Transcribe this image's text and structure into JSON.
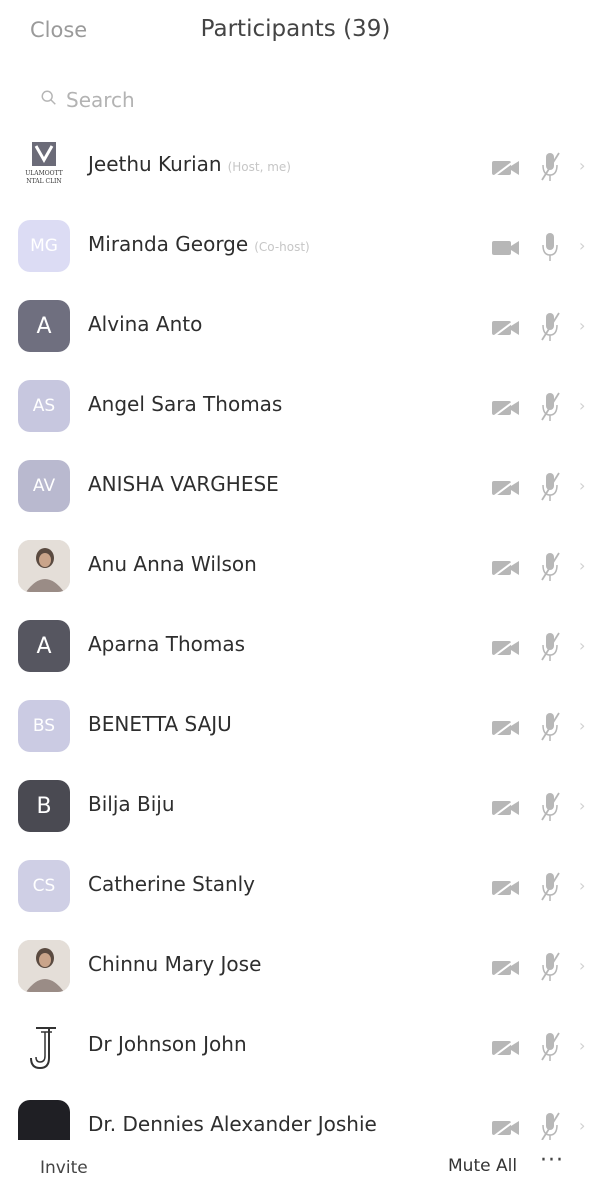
{
  "header": {
    "close_label": "Close",
    "title": "Participants (39)"
  },
  "search": {
    "placeholder": "Search",
    "icon": "search-icon"
  },
  "participants": [
    {
      "name": "Jeethu Kurian",
      "role": "(Host, me)",
      "avatar_type": "logo",
      "logo_text": "ULAMOOTT NTAL CLIN",
      "video": "off",
      "audio": "muted"
    },
    {
      "name": "Miranda George",
      "role": "(Co-host)",
      "avatar_type": "initials",
      "initials": "MG",
      "avatar_color": "#dcdcf4",
      "video": "on",
      "audio": "unmuted"
    },
    {
      "name": "Alvina Anto",
      "avatar_type": "initials",
      "initials": "A",
      "avatar_color": "#6f6f7f",
      "video": "off",
      "audio": "muted"
    },
    {
      "name": "Angel Sara Thomas",
      "avatar_type": "initials",
      "initials": "AS",
      "avatar_color": "#c7c7df",
      "video": "off",
      "audio": "muted"
    },
    {
      "name": "ANISHA VARGHESE",
      "avatar_type": "initials",
      "initials": "AV",
      "avatar_color": "#b9b9cf",
      "video": "off",
      "audio": "muted"
    },
    {
      "name": "Anu Anna Wilson",
      "avatar_type": "photo",
      "video": "off",
      "audio": "muted"
    },
    {
      "name": "Aparna Thomas",
      "avatar_type": "initials",
      "initials": "A",
      "avatar_color": "#565660",
      "video": "off",
      "audio": "muted"
    },
    {
      "name": "BENETTA SAJU",
      "avatar_type": "initials",
      "initials": "BS",
      "avatar_color": "#cbcbe3",
      "video": "off",
      "audio": "muted"
    },
    {
      "name": "Bilja Biju",
      "avatar_type": "initials",
      "initials": "B",
      "avatar_color": "#4a4a52",
      "video": "off",
      "audio": "muted"
    },
    {
      "name": "Catherine Stanly",
      "avatar_type": "initials",
      "initials": "CS",
      "avatar_color": "#cfcfe5",
      "video": "off",
      "audio": "muted"
    },
    {
      "name": "Chinnu Mary Jose",
      "avatar_type": "photo",
      "video": "off",
      "audio": "muted"
    },
    {
      "name": "Dr Johnson John",
      "avatar_type": "letter-logo",
      "initials": "J",
      "video": "off",
      "audio": "muted"
    },
    {
      "name": "Dr. Dennies Alexander Joshie",
      "avatar_type": "initials",
      "initials": "",
      "avatar_color": "#1f1f24",
      "video": "off",
      "audio": "muted"
    }
  ],
  "footer": {
    "invite_label": "Invite",
    "mute_all_label": "Mute All",
    "more_label": "···"
  },
  "colors": {
    "muted_icon": "#b7b7b7",
    "text": "#2e2e2e"
  }
}
